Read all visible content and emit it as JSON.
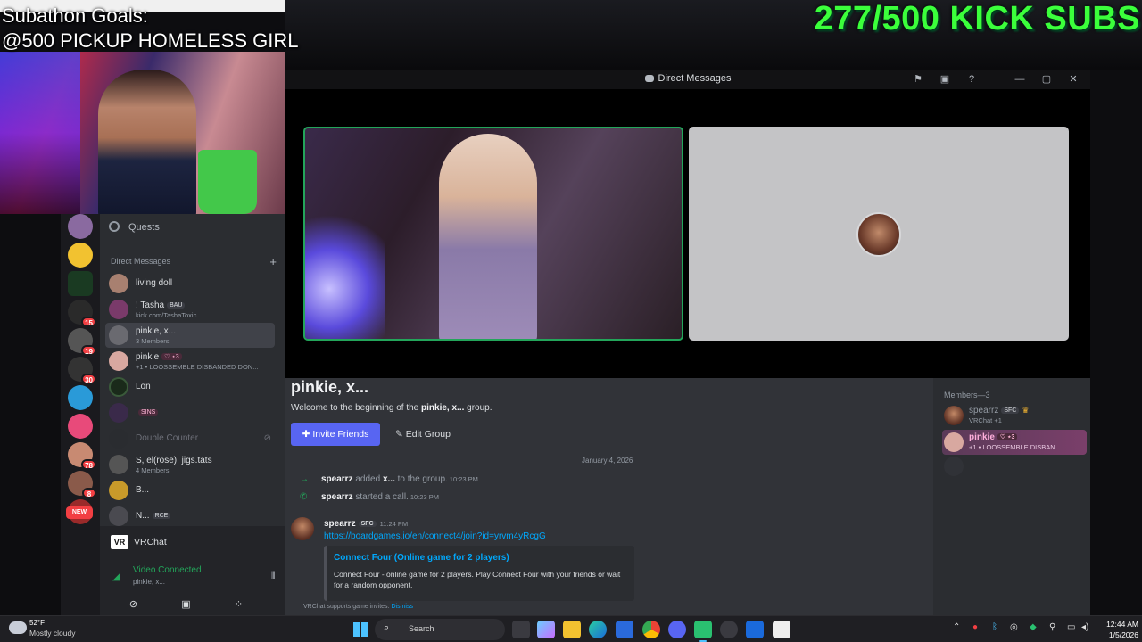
{
  "overlay": {
    "goals_title": "Subathon Goals:",
    "goals_line": "@500 PICKUP HOMELESS GIRL",
    "subs_counter": "277/500 KICK SUBS"
  },
  "window": {
    "title": "Direct Messages",
    "icons": [
      "flag-icon",
      "inbox-icon",
      "help-icon",
      "minimize-icon",
      "maximize-icon",
      "close-icon"
    ]
  },
  "rail": {
    "badges": {
      "server_a": "15",
      "server_b": "19",
      "server_c": "30",
      "server_d": "78",
      "server_e": "8"
    },
    "new_label": "NEW"
  },
  "sidebar": {
    "quests_label": "Quests",
    "dm_header": "Direct Messages",
    "add_dm": "+",
    "dms": [
      {
        "name": "living doll",
        "sub": ""
      },
      {
        "name": "! Tasha",
        "tag": "BAU",
        "sub": "kick.com/TashaToxic"
      },
      {
        "name": "pinkie, x...",
        "sub": "3 Members"
      },
      {
        "name": "pinkie",
        "tag": "♡ ⋆3",
        "sub": "+1 • LOOSSEMBLE DISBANDED DON..."
      },
      {
        "name": "Lon",
        "sub": ""
      },
      {
        "name": "",
        "tag": "SINS",
        "sub": ""
      },
      {
        "name": "Double Counter",
        "sub": ""
      },
      {
        "name": "S, el(rose), jigs.tats",
        "sub": "4 Members"
      },
      {
        "name": "B...",
        "sub": ""
      },
      {
        "name": "N...",
        "tag": "RCE",
        "sub": ""
      }
    ]
  },
  "voice": {
    "app_name": "VRChat",
    "status": "Video Connected",
    "channel": "pinkie, x..."
  },
  "chat": {
    "group_title": "pinkie, x...",
    "welcome_prefix": "Welcome to the beginning of the ",
    "welcome_group": "pinkie, x...",
    "welcome_suffix": " group.",
    "invite_btn": "Invite Friends",
    "edit_btn": "Edit Group",
    "date": "January 4, 2026",
    "sys1": {
      "actor": "spearrz",
      "text": " added ",
      "target": "x...",
      "rest": " to the group.",
      "time": "10:23 PM"
    },
    "sys2": {
      "actor": "spearrz",
      "text": " started a call.",
      "time": "10:23 PM"
    },
    "msg": {
      "author": "spearrz",
      "tag": "SFC",
      "time": "11:24 PM",
      "link": "https://boardgames.io/en/connect4/join?id=yrvm4yRcgG",
      "embed_title": "Connect Four (Online game for 2 players)",
      "embed_desc": "Connect Four - online game for 2 players. Play Connect Four with your friends or wait for a random opponent."
    },
    "notice": "VRChat supports game invites.",
    "notice_dismiss": "Dismiss"
  },
  "members": {
    "header": "Members—3",
    "list": [
      {
        "name": "spearrz",
        "tag": "SFC",
        "sub": "VRChat +1"
      },
      {
        "name": "pinkie",
        "tag": "♡ ⋆3",
        "sub": "+1 • LOOSSEMBLE DISBAN..."
      }
    ]
  },
  "taskbar": {
    "temp": "52°F",
    "weather": "Mostly cloudy",
    "search": "Search",
    "time": "12:44 AM",
    "date": "1/5/2026"
  },
  "colors": {
    "accent": "#5865f2",
    "online": "#23a55a",
    "subs_green": "#3bff3b",
    "danger": "#f23f43"
  }
}
